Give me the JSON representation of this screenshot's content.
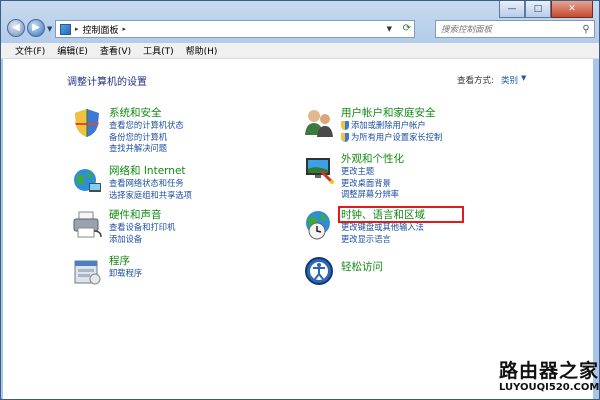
{
  "window": {
    "caption_buttons": {
      "minimize": "—",
      "maximize": "□",
      "close": "✕"
    },
    "nav": {
      "back": "◀",
      "forward": "▶"
    },
    "address": {
      "path": "控制面板",
      "separator": "▸"
    },
    "search": {
      "placeholder": "搜索控制面板"
    }
  },
  "menubar": {
    "items": [
      "文件(F)",
      "编辑(E)",
      "查看(V)",
      "工具(T)",
      "帮助(H)"
    ]
  },
  "content": {
    "title": "调整计算机的设置",
    "view_by": {
      "label": "查看方式:",
      "value": "类别"
    },
    "left_categories": [
      {
        "title": "系统和安全",
        "icon": "shield-icon",
        "links": [
          "查看您的计算机状态",
          "备份您的计算机",
          "查找并解决问题"
        ]
      },
      {
        "title": "网络和 Internet",
        "icon": "network-icon",
        "links": [
          "查看网络状态和任务",
          "选择家庭组和共享选项"
        ]
      },
      {
        "title": "硬件和声音",
        "icon": "printer-icon",
        "links": [
          "查看设备和打印机",
          "添加设备"
        ]
      },
      {
        "title": "程序",
        "icon": "programs-icon",
        "links": [
          "卸载程序"
        ]
      }
    ],
    "right_categories": [
      {
        "title": "用户帐户和家庭安全",
        "icon": "users-icon",
        "links": [
          "添加或删除用户帐户",
          "为所有用户设置家长控制"
        ],
        "shield_links": [
          true,
          true
        ]
      },
      {
        "title": "外观和个性化",
        "icon": "display-icon",
        "links": [
          "更改主题",
          "更改桌面背景",
          "调整屏幕分辨率"
        ]
      },
      {
        "title": "时钟、语言和区域",
        "icon": "globe-clock-icon",
        "links": [
          "更改键盘或其他输入法",
          "更改显示语言"
        ],
        "highlighted": true
      },
      {
        "title": "轻松访问",
        "icon": "ease-of-access-icon",
        "links": []
      }
    ]
  },
  "watermark": {
    "title": "路由器之家",
    "url": "LUYOUQI520.COM"
  },
  "colors": {
    "title_green": "#128a12",
    "link_blue": "#1c4fa0",
    "highlight_red": "#e11a1a"
  }
}
